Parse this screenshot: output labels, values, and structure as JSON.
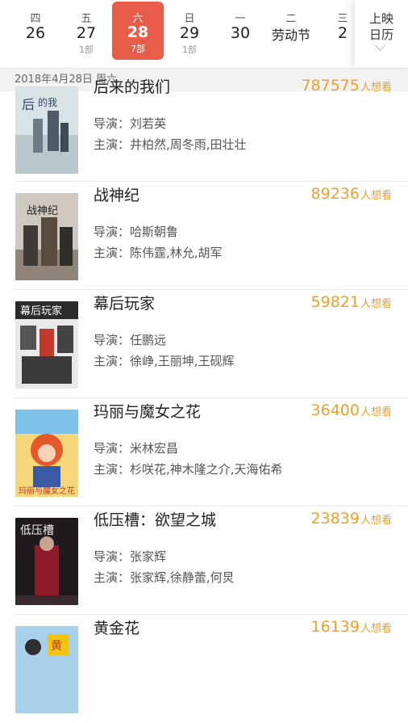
{
  "dates": [
    {
      "weekday": "四",
      "day": "26",
      "count": ""
    },
    {
      "weekday": "五",
      "day": "27",
      "count": "1部"
    },
    {
      "weekday": "六",
      "day": "28",
      "count": "7部",
      "selected": true
    },
    {
      "weekday": "日",
      "day": "29",
      "count": "1部"
    },
    {
      "weekday": "一",
      "day": "30",
      "count": ""
    },
    {
      "weekday": "二",
      "day": "劳动节",
      "count": ""
    },
    {
      "weekday": "三",
      "day": "2",
      "count": ""
    }
  ],
  "calendar_button": {
    "line1": "上映",
    "line2": "日历"
  },
  "section_date": "2018年4月28日 周六",
  "labels": {
    "director": "导演：",
    "cast": "主演："
  },
  "wish_suffix": "人想看",
  "movies": [
    {
      "title": "后来的我们",
      "wish": "787575",
      "director": "刘若英",
      "cast": "井柏然,周冬雨,田壮壮",
      "poster_text": "后来的我们",
      "poster_color": "#cfd8dc"
    },
    {
      "title": "战神纪",
      "wish": "89236",
      "director": "哈斯朝鲁",
      "cast": "陈伟霆,林允,胡军",
      "poster_text": "战神纪",
      "poster_color": "#5b4f44"
    },
    {
      "title": "幕后玩家",
      "wish": "59821",
      "director": "任鹏远",
      "cast": "徐峥,王丽坤,王砚辉",
      "poster_text": "幕后玩家",
      "poster_color": "#3a3a3a"
    },
    {
      "title": "玛丽与魔女之花",
      "wish": "36400",
      "director": "米林宏昌",
      "cast": "杉咲花,神木隆之介,天海佑希",
      "poster_text": "玛丽与魔女之花",
      "poster_color": "#e8a23a"
    },
    {
      "title": "低压槽：欲望之城",
      "wish": "23839",
      "director": "张家辉",
      "cast": "张家辉,徐静蕾,何炅",
      "poster_text": "低压槽",
      "poster_color": "#2a1f24"
    },
    {
      "title": "黄金花",
      "wish": "16139",
      "director": "",
      "cast": "",
      "poster_text": "黄金花",
      "poster_color": "#7fb3d5"
    }
  ],
  "colors": {
    "accent": "#e85d4a",
    "wish": "#f0a026"
  }
}
